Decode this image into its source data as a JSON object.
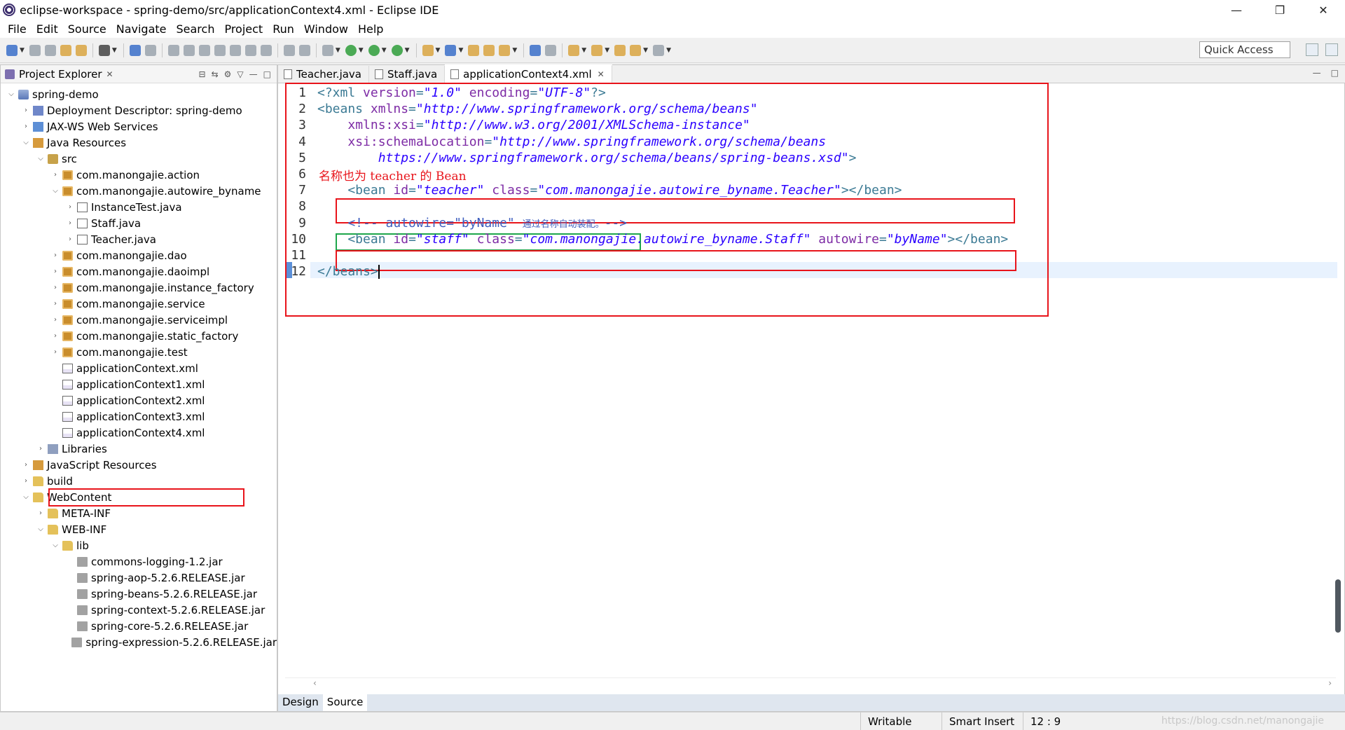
{
  "window": {
    "title": "eclipse-workspace - spring-demo/src/applicationContext4.xml - Eclipse IDE",
    "minimize": "—",
    "maximize": "❐",
    "close": "✕"
  },
  "menu": [
    "File",
    "Edit",
    "Source",
    "Navigate",
    "Search",
    "Project",
    "Run",
    "Window",
    "Help"
  ],
  "toolbar": {
    "quick_access_placeholder": "Quick Access"
  },
  "explorer": {
    "title": "Project Explorer",
    "close": "✕",
    "tree": [
      {
        "label": "spring-demo",
        "icon": "project-icon",
        "depth": 0,
        "twisty": "v"
      },
      {
        "label": "Deployment Descriptor: spring-demo",
        "icon": "descriptor-icon",
        "depth": 1,
        "twisty": ">"
      },
      {
        "label": "JAX-WS Web Services",
        "icon": "webservice-icon",
        "depth": 1,
        "twisty": ">"
      },
      {
        "label": "Java Resources",
        "icon": "java-resources-icon",
        "depth": 1,
        "twisty": "v"
      },
      {
        "label": "src",
        "icon": "source-folder-icon",
        "depth": 2,
        "twisty": "v"
      },
      {
        "label": "com.manongajie.action",
        "icon": "package-icon",
        "depth": 3,
        "twisty": ">"
      },
      {
        "label": "com.manongajie.autowire_byname",
        "icon": "package-icon",
        "depth": 3,
        "twisty": "v"
      },
      {
        "label": "InstanceTest.java",
        "icon": "java-file-icon",
        "depth": 4,
        "twisty": ">"
      },
      {
        "label": "Staff.java",
        "icon": "java-file-icon",
        "depth": 4,
        "twisty": ">"
      },
      {
        "label": "Teacher.java",
        "icon": "java-file-icon",
        "depth": 4,
        "twisty": ">"
      },
      {
        "label": "com.manongajie.dao",
        "icon": "package-icon",
        "depth": 3,
        "twisty": ">"
      },
      {
        "label": "com.manongajie.daoimpl",
        "icon": "package-icon",
        "depth": 3,
        "twisty": ">"
      },
      {
        "label": "com.manongajie.instance_factory",
        "icon": "package-icon",
        "depth": 3,
        "twisty": ">"
      },
      {
        "label": "com.manongajie.service",
        "icon": "package-icon",
        "depth": 3,
        "twisty": ">"
      },
      {
        "label": "com.manongajie.serviceimpl",
        "icon": "package-icon",
        "depth": 3,
        "twisty": ">"
      },
      {
        "label": "com.manongajie.static_factory",
        "icon": "package-icon",
        "depth": 3,
        "twisty": ">"
      },
      {
        "label": "com.manongajie.test",
        "icon": "package-icon",
        "depth": 3,
        "twisty": ">"
      },
      {
        "label": "applicationContext.xml",
        "icon": "xml-file-icon",
        "depth": 3,
        "twisty": ""
      },
      {
        "label": "applicationContext1.xml",
        "icon": "xml-file-icon",
        "depth": 3,
        "twisty": ""
      },
      {
        "label": "applicationContext2.xml",
        "icon": "xml-file-icon",
        "depth": 3,
        "twisty": ""
      },
      {
        "label": "applicationContext3.xml",
        "icon": "xml-file-icon",
        "depth": 3,
        "twisty": ""
      },
      {
        "label": "applicationContext4.xml",
        "icon": "xml-file-icon",
        "depth": 3,
        "twisty": ""
      },
      {
        "label": "Libraries",
        "icon": "libraries-icon",
        "depth": 2,
        "twisty": ">"
      },
      {
        "label": "JavaScript Resources",
        "icon": "js-resources-icon",
        "depth": 1,
        "twisty": ">"
      },
      {
        "label": "build",
        "icon": "folder-icon",
        "depth": 1,
        "twisty": ">"
      },
      {
        "label": "WebContent",
        "icon": "folder-icon",
        "depth": 1,
        "twisty": "v"
      },
      {
        "label": "META-INF",
        "icon": "folder-icon",
        "depth": 2,
        "twisty": ">"
      },
      {
        "label": "WEB-INF",
        "icon": "folder-icon",
        "depth": 2,
        "twisty": "v"
      },
      {
        "label": "lib",
        "icon": "folder-icon",
        "depth": 3,
        "twisty": "v"
      },
      {
        "label": "commons-logging-1.2.jar",
        "icon": "jar-icon",
        "depth": 4,
        "twisty": ""
      },
      {
        "label": "spring-aop-5.2.6.RELEASE.jar",
        "icon": "jar-icon",
        "depth": 4,
        "twisty": ""
      },
      {
        "label": "spring-beans-5.2.6.RELEASE.jar",
        "icon": "jar-icon",
        "depth": 4,
        "twisty": ""
      },
      {
        "label": "spring-context-5.2.6.RELEASE.jar",
        "icon": "jar-icon",
        "depth": 4,
        "twisty": ""
      },
      {
        "label": "spring-core-5.2.6.RELEASE.jar",
        "icon": "jar-icon",
        "depth": 4,
        "twisty": ""
      },
      {
        "label": "spring-expression-5.2.6.RELEASE.jar",
        "icon": "jar-icon",
        "depth": 4,
        "twisty": ""
      }
    ]
  },
  "editor": {
    "tabs": [
      {
        "label": "Teacher.java",
        "active": false
      },
      {
        "label": "Staff.java",
        "active": false
      },
      {
        "label": "applicationContext4.xml",
        "active": true
      }
    ],
    "tab_close": "✕",
    "annotation": "名称也为 teacher 的 Bean",
    "lines": [
      {
        "n": "1",
        "tokens": [
          [
            "t-tag",
            "<?xml "
          ],
          [
            "t-attr",
            "version"
          ],
          [
            "t-tag",
            "="
          ],
          [
            "t-str",
            "\"1.0\""
          ],
          [
            "t-tag",
            " "
          ],
          [
            "t-attr",
            "encoding"
          ],
          [
            "t-tag",
            "="
          ],
          [
            "t-str",
            "\"UTF-8\""
          ],
          [
            "t-tag",
            "?>"
          ]
        ]
      },
      {
        "n": "2",
        "tokens": [
          [
            "t-tag",
            "<beans "
          ],
          [
            "t-attr",
            "xmlns"
          ],
          [
            "t-tag",
            "="
          ],
          [
            "t-str",
            "\"http://www.springframework.org/schema/beans\""
          ]
        ]
      },
      {
        "n": "3",
        "tokens": [
          [
            "t-tag",
            "    "
          ],
          [
            "t-attr",
            "xmlns:xsi"
          ],
          [
            "t-tag",
            "="
          ],
          [
            "t-str",
            "\"http://www.w3.org/2001/XMLSchema-instance\""
          ]
        ]
      },
      {
        "n": "4",
        "tokens": [
          [
            "t-tag",
            "    "
          ],
          [
            "t-attr",
            "xsi:schemaLocation"
          ],
          [
            "t-tag",
            "="
          ],
          [
            "t-str",
            "\"http://www.springframework.org/schema/beans"
          ]
        ]
      },
      {
        "n": "5",
        "tokens": [
          [
            "t-str",
            "        https://www.springframework.org/schema/beans/spring-beans.xsd\""
          ],
          [
            "t-tag",
            ">"
          ]
        ]
      },
      {
        "n": "6",
        "tokens": []
      },
      {
        "n": "7",
        "tokens": [
          [
            "t-tag",
            "    <bean "
          ],
          [
            "t-attr",
            "id"
          ],
          [
            "t-tag",
            "="
          ],
          [
            "t-str",
            "\"teacher\""
          ],
          [
            "t-tag",
            " "
          ],
          [
            "t-attr",
            "class"
          ],
          [
            "t-tag",
            "="
          ],
          [
            "t-str",
            "\"com.manongajie.autowire_byname.Teacher\""
          ],
          [
            "t-tag",
            "></bean>"
          ]
        ]
      },
      {
        "n": "8",
        "tokens": []
      },
      {
        "n": "9",
        "tokens": [
          [
            "t-cmt",
            "    <!-- autowire=\"byName\" "
          ],
          [
            "t-cjk",
            "通过名称自动装配。"
          ],
          [
            "t-cmt",
            "-->"
          ]
        ]
      },
      {
        "n": "10",
        "tokens": [
          [
            "t-tag",
            "    <bean "
          ],
          [
            "t-attr",
            "id"
          ],
          [
            "t-tag",
            "="
          ],
          [
            "t-str",
            "\"staff\""
          ],
          [
            "t-tag",
            " "
          ],
          [
            "t-attr",
            "class"
          ],
          [
            "t-tag",
            "="
          ],
          [
            "t-str",
            "\"com.manongajie.autowire_byname.Staff\""
          ],
          [
            "t-tag",
            " "
          ],
          [
            "t-attr",
            "autowire"
          ],
          [
            "t-tag",
            "="
          ],
          [
            "t-str",
            "\"byName\""
          ],
          [
            "t-tag",
            "></bean>"
          ]
        ]
      },
      {
        "n": "11",
        "tokens": []
      },
      {
        "n": "12",
        "tokens": [
          [
            "t-tag",
            "</beans>"
          ]
        ]
      }
    ],
    "bottom_tabs": [
      "Design",
      "Source"
    ],
    "active_bottom_tab": "Source"
  },
  "status": {
    "writable": "Writable",
    "insert_mode": "Smart Insert",
    "position": "12 : 9",
    "watermark": "https://blog.csdn.net/manongajie"
  },
  "colors": {
    "highlight_red": "#e8141b",
    "highlight_green": "#1ea64b"
  }
}
